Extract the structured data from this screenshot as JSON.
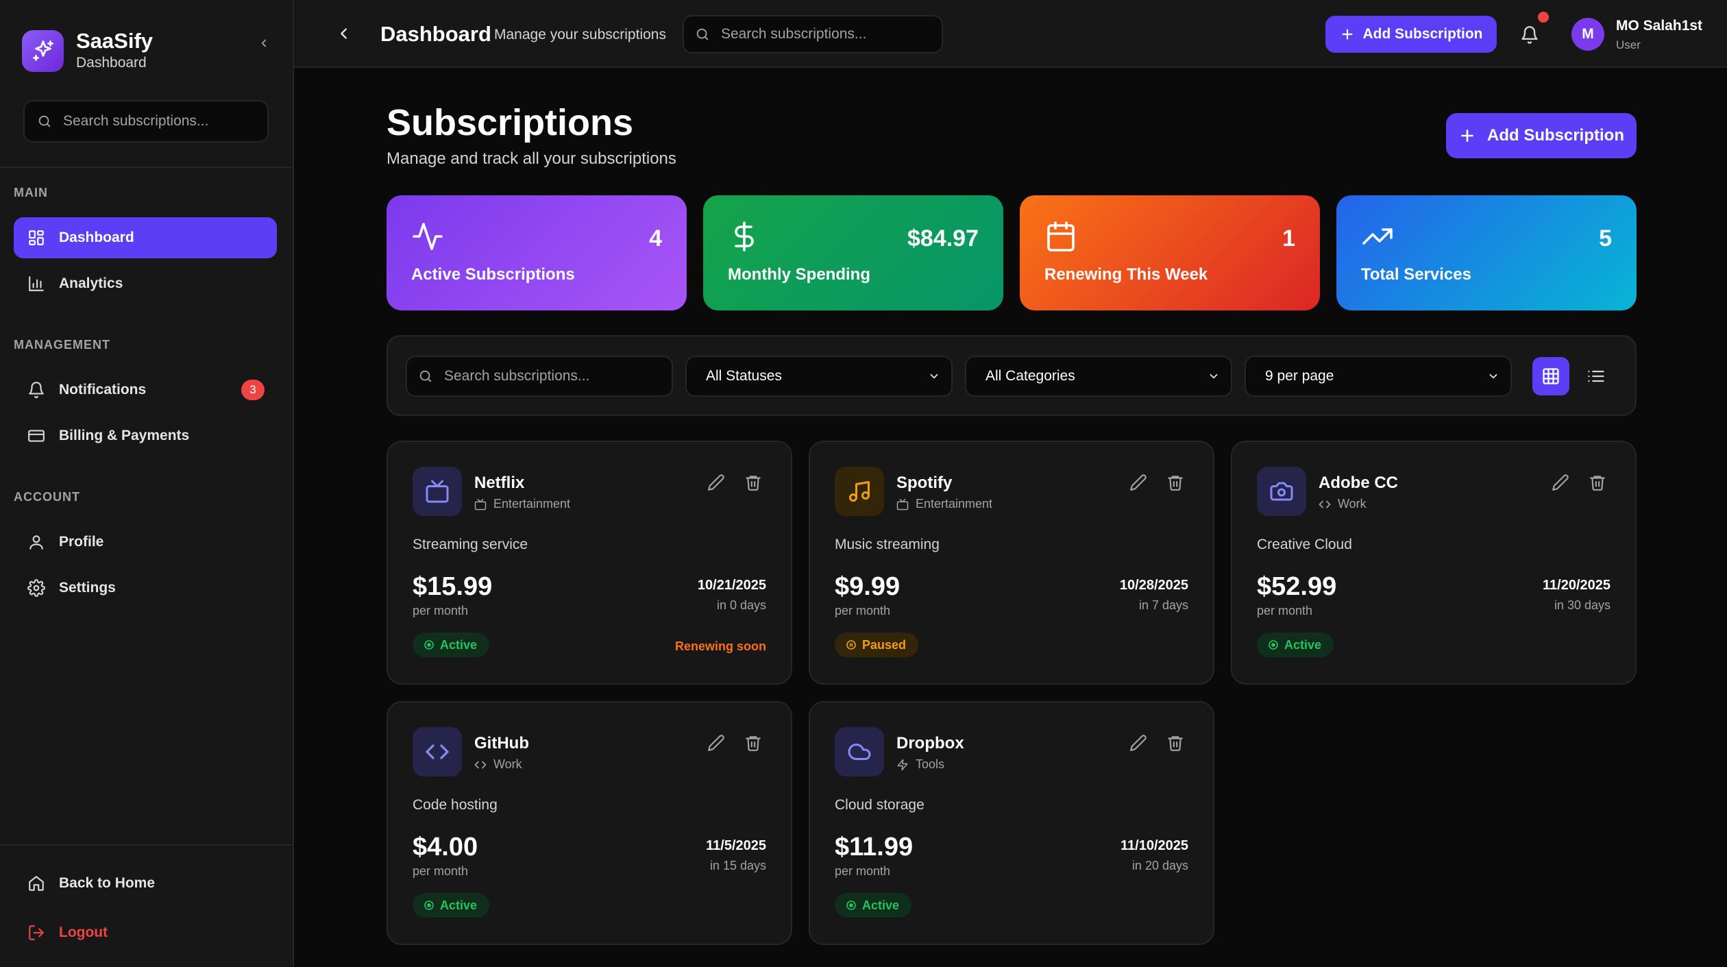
{
  "colors": {
    "accent": "#5b3ef5",
    "danger": "#ef4444",
    "success": "#22c55e",
    "warning": "#f59e0b"
  },
  "sidebar": {
    "brand_name": "SaaSify",
    "brand_sub": "Dashboard",
    "search_placeholder": "Search subscriptions...",
    "sections": {
      "main": "MAIN",
      "management": "MANAGEMENT",
      "account": "ACCOUNT"
    },
    "items": {
      "dashboard": "Dashboard",
      "analytics": "Analytics",
      "notifications": "Notifications",
      "notifications_badge": "3",
      "billing": "Billing & Payments",
      "profile": "Profile",
      "settings": "Settings",
      "back_home": "Back to Home",
      "logout": "Logout"
    }
  },
  "header": {
    "title": "Dashboard",
    "subtitle": "Manage your subscriptions",
    "search_placeholder": "Search subscriptions...",
    "add_label": "Add Subscription",
    "user_initial": "M",
    "user_name": "MO Salah1st",
    "user_role": "User"
  },
  "main": {
    "title": "Subscriptions",
    "subtitle": "Manage and track all your subscriptions",
    "add_label": "Add Subscription"
  },
  "stats": [
    {
      "icon": "activity-icon",
      "value": "4",
      "label": "Active Subscriptions"
    },
    {
      "icon": "dollar-icon",
      "value": "$84.97",
      "label": "Monthly Spending"
    },
    {
      "icon": "calendar-icon",
      "value": "1",
      "label": "Renewing This Week"
    },
    {
      "icon": "trending-up-icon",
      "value": "5",
      "label": "Total Services"
    }
  ],
  "filters": {
    "search_placeholder": "Search subscriptions...",
    "status": "All Statuses",
    "category": "All Categories",
    "per_page": "9 per page"
  },
  "cards": [
    {
      "name": "Netflix",
      "icon": "tv-icon",
      "category_icon": "tv-icon",
      "category": "Entertainment",
      "description": "Streaming service",
      "price": "$15.99",
      "period": "per month",
      "date": "10/21/2025",
      "days": "in 0 days",
      "status": "Active",
      "note": "Renewing soon"
    },
    {
      "name": "Spotify",
      "icon": "music-icon",
      "category_icon": "tv-icon",
      "category": "Entertainment",
      "description": "Music streaming",
      "price": "$9.99",
      "period": "per month",
      "date": "10/28/2025",
      "days": "in 7 days",
      "status": "Paused",
      "note": ""
    },
    {
      "name": "Adobe CC",
      "icon": "camera-icon",
      "category_icon": "code-icon",
      "category": "Work",
      "description": "Creative Cloud",
      "price": "$52.99",
      "period": "per month",
      "date": "11/20/2025",
      "days": "in 30 days",
      "status": "Active",
      "note": ""
    },
    {
      "name": "GitHub",
      "icon": "code-icon",
      "category_icon": "code-icon",
      "category": "Work",
      "description": "Code hosting",
      "price": "$4.00",
      "period": "per month",
      "date": "11/5/2025",
      "days": "in 15 days",
      "status": "Active",
      "note": ""
    },
    {
      "name": "Dropbox",
      "icon": "cloud-icon",
      "category_icon": "zap-icon",
      "category": "Tools",
      "description": "Cloud storage",
      "price": "$11.99",
      "period": "per month",
      "date": "11/10/2025",
      "days": "in 20 days",
      "status": "Active",
      "note": ""
    }
  ]
}
